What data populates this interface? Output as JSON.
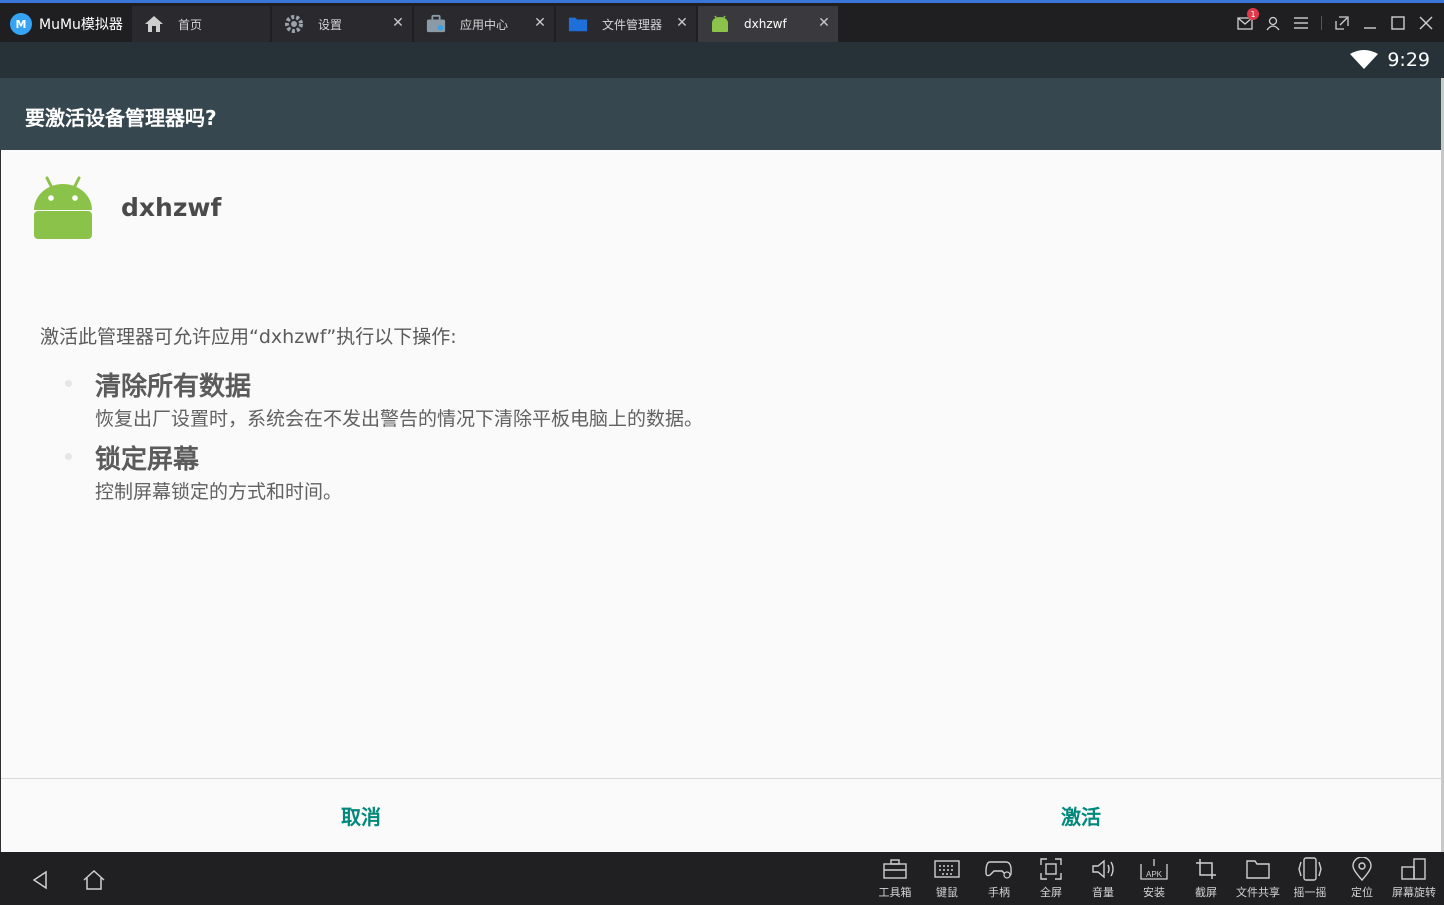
{
  "app": {
    "name": "MuMu模拟器"
  },
  "tabs": [
    {
      "label": "首页",
      "icon": "home-icon",
      "closable": false
    },
    {
      "label": "设置",
      "icon": "gear-icon",
      "closable": true
    },
    {
      "label": "应用中心",
      "icon": "app-center-icon",
      "closable": true
    },
    {
      "label": "文件管理器",
      "icon": "folder-icon",
      "closable": true
    },
    {
      "label": "dxhzwf",
      "icon": "android-icon",
      "closable": true,
      "active": true
    }
  ],
  "window_controls": {
    "notification_count": "1",
    "icons": [
      "mail-icon",
      "user-icon",
      "menu-icon",
      "restore-icon",
      "minimize-icon",
      "maximize-icon",
      "close-icon"
    ]
  },
  "status_bar": {
    "time": "9:29",
    "wifi": "wifi-icon"
  },
  "dialog": {
    "title": "要激活设备管理器吗?",
    "app_name": "dxhzwf",
    "description": "激活此管理器可允许应用“dxhzwf”执行以下操作:",
    "policies": [
      {
        "title": "清除所有数据",
        "desc": "恢复出厂设置时，系统会在不发出警告的情况下清除平板电脑上的数据。"
      },
      {
        "title": "锁定屏幕",
        "desc": "控制屏幕锁定的方式和时间。"
      }
    ],
    "cancel_label": "取消",
    "activate_label": "激活"
  },
  "colors": {
    "accent": "#00897b",
    "header": "#37474f",
    "statusbar": "#263238",
    "android_green": "#8bc34a"
  },
  "toolbar": [
    {
      "label": "工具箱",
      "icon": "toolbox-icon"
    },
    {
      "label": "键鼠",
      "icon": "keyboard-icon"
    },
    {
      "label": "手柄",
      "icon": "gamepad-icon"
    },
    {
      "label": "全屏",
      "icon": "fullscreen-icon"
    },
    {
      "label": "音量",
      "icon": "volume-icon"
    },
    {
      "label": "安装",
      "icon": "apk-install-icon"
    },
    {
      "label": "截屏",
      "icon": "crop-icon"
    },
    {
      "label": "文件共享",
      "icon": "folder-share-icon"
    },
    {
      "label": "摇一摇",
      "icon": "shake-icon"
    },
    {
      "label": "定位",
      "icon": "location-icon"
    },
    {
      "label": "屏幕旋转",
      "icon": "rotate-icon"
    }
  ]
}
